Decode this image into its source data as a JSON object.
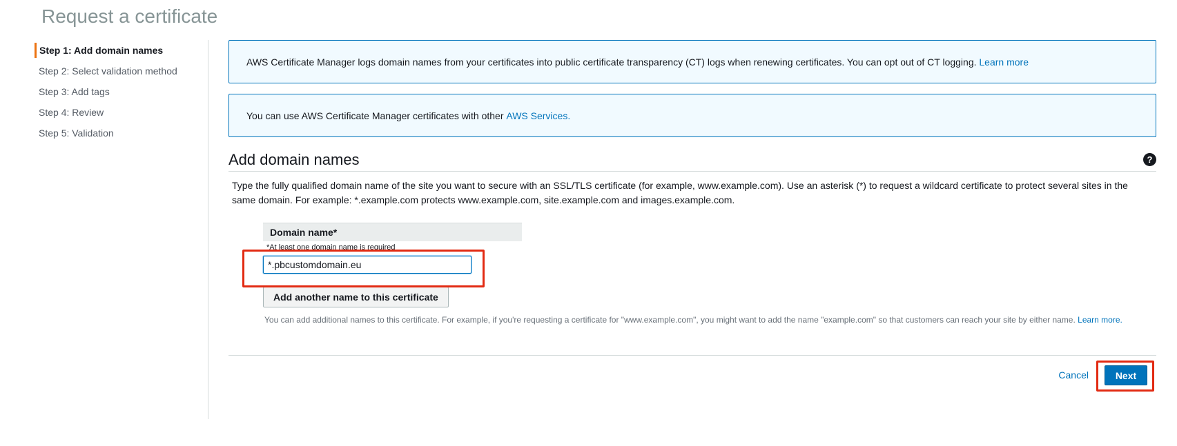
{
  "page": {
    "title": "Request a certificate"
  },
  "sidebar": {
    "steps": [
      {
        "label": "Step 1: Add domain names",
        "active": true
      },
      {
        "label": "Step 2: Select validation method",
        "active": false
      },
      {
        "label": "Step 3: Add tags",
        "active": false
      },
      {
        "label": "Step 4: Review",
        "active": false
      },
      {
        "label": "Step 5: Validation",
        "active": false
      }
    ]
  },
  "notices": {
    "ct_logging": {
      "text": "AWS Certificate Manager logs domain names from your certificates into public certificate transparency (CT) logs when renewing certificates. You can opt out of CT logging.",
      "link": "Learn more"
    },
    "services": {
      "text": "You can use AWS Certificate Manager certificates with other",
      "link": "AWS Services."
    }
  },
  "section": {
    "title": "Add domain names",
    "help_icon": "question-mark-icon",
    "help_glyph": "?",
    "description": "Type the fully qualified domain name of the site you want to secure with an SSL/TLS certificate (for example, www.example.com). Use an asterisk (*) to request a wildcard certificate to protect several sites in the same domain. For example: *.example.com protects www.example.com, site.example.com and images.example.com."
  },
  "domain": {
    "header": "Domain name*",
    "required_note": "*At least one domain name is required",
    "value": "*.pbcustomdomain.eu",
    "add_button": "Add another name to this certificate",
    "add_note_text": "You can add additional names to this certificate. For example, if you're requesting a certificate for \"www.example.com\", you might want to add the name \"example.com\" so that customers can reach your site by either name.",
    "add_note_link": "Learn more."
  },
  "footer": {
    "cancel": "Cancel",
    "next": "Next"
  },
  "colors": {
    "link": "#0073bb",
    "highlight": "#e22a12",
    "active_step": "#ec7211",
    "primary_button": "#0073bb"
  }
}
